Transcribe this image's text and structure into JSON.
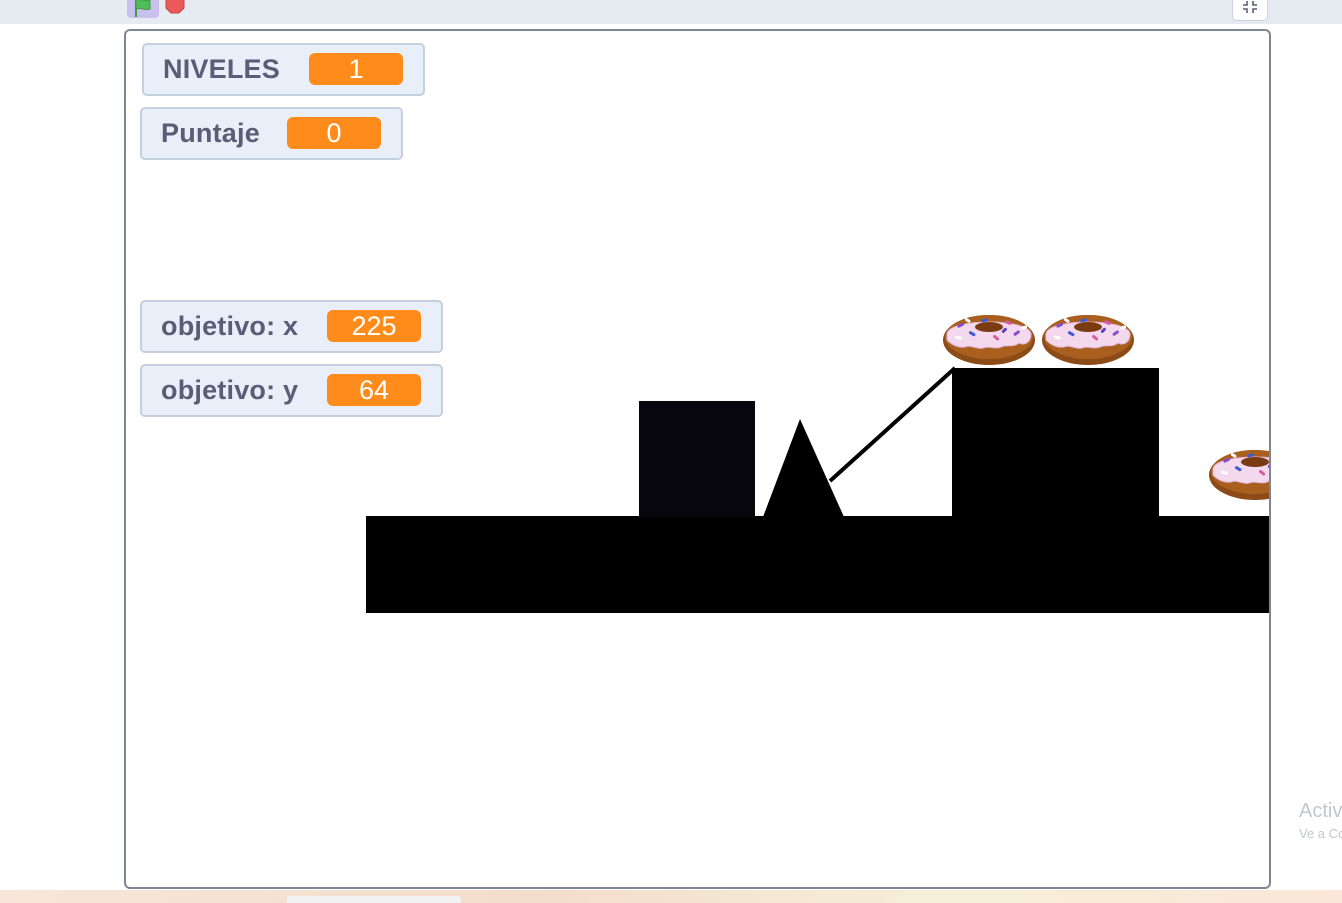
{
  "toolbar": {
    "green_flag_icon": "green-flag",
    "stop_icon": "stop-sign",
    "fullscreen_icon": "exit-fullscreen",
    "flag_color": "#4cbf56",
    "stop_color": "#ec5959"
  },
  "monitors": [
    {
      "label": "NIVELES",
      "value": "1"
    },
    {
      "label": "Puntaje",
      "value": "0"
    },
    {
      "label": "objetivo: x",
      "value": "225"
    },
    {
      "label": "objetivo: y",
      "value": "64"
    }
  ],
  "stage": {
    "sprites": [
      "donut",
      "donut",
      "donut"
    ],
    "platform_color": "#000000",
    "value_color": "#ff8c1a"
  },
  "watermark": {
    "title": "Activ",
    "subtitle": "Ve a Co"
  }
}
